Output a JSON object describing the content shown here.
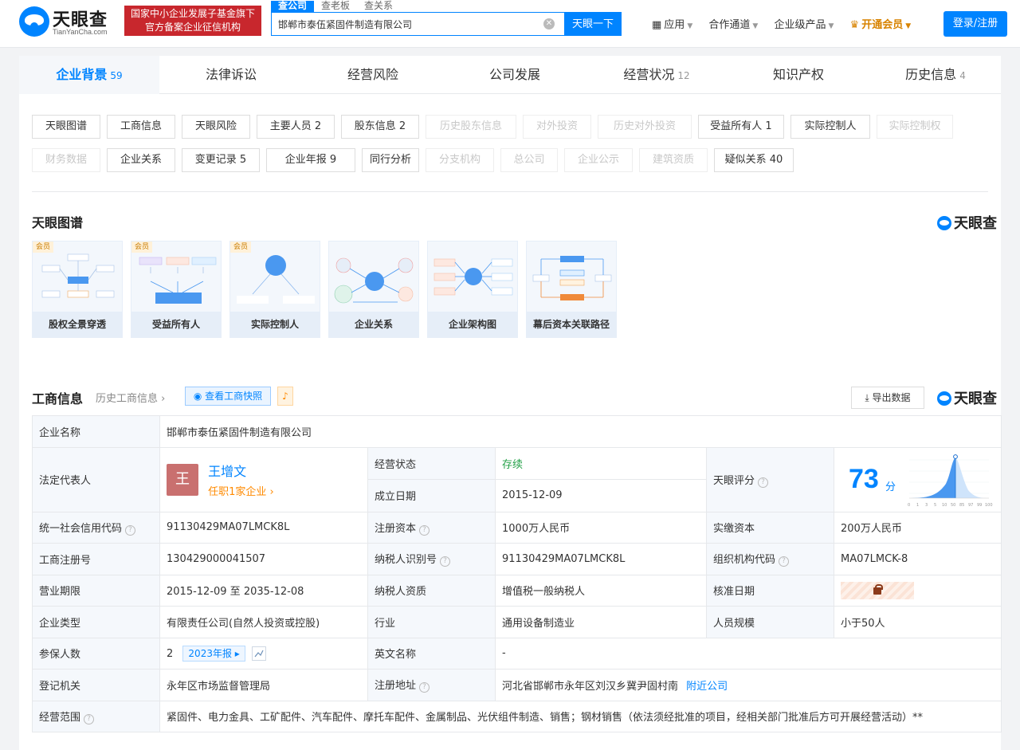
{
  "header": {
    "logo_text": "天眼查",
    "logo_sub": "TianYanCha.com",
    "badge_line1": "国家中小企业发展子基金旗下",
    "badge_line2": "官方备案企业征信机构",
    "search_tabs": [
      "查公司",
      "查老板",
      "查关系"
    ],
    "search_value": "邯郸市泰伍紧固件制造有限公司",
    "search_button": "天眼一下",
    "nav": [
      "应用",
      "合作通道",
      "企业级产品",
      "开通会员"
    ],
    "login": "登录/注册"
  },
  "tabs": [
    {
      "label": "企业背景",
      "count": "59"
    },
    {
      "label": "法律诉讼",
      "count": ""
    },
    {
      "label": "经营风险",
      "count": ""
    },
    {
      "label": "公司发展",
      "count": ""
    },
    {
      "label": "经营状况",
      "count": "12"
    },
    {
      "label": "知识产权",
      "count": ""
    },
    {
      "label": "历史信息",
      "count": "4"
    }
  ],
  "chips_row1": [
    {
      "label": "天眼图谱",
      "disabled": false
    },
    {
      "label": "工商信息",
      "disabled": false
    },
    {
      "label": "天眼风险",
      "disabled": false
    },
    {
      "label": "主要人员 2",
      "disabled": false
    },
    {
      "label": "股东信息 2",
      "disabled": false
    },
    {
      "label": "历史股东信息",
      "disabled": true
    },
    {
      "label": "对外投资",
      "disabled": true
    },
    {
      "label": "历史对外投资",
      "disabled": true
    },
    {
      "label": "受益所有人 1",
      "disabled": false
    },
    {
      "label": "实际控制人",
      "disabled": false
    },
    {
      "label": "实际控制权",
      "disabled": true
    }
  ],
  "chips_row2": [
    {
      "label": "财务数据",
      "disabled": true
    },
    {
      "label": "企业关系",
      "disabled": false
    },
    {
      "label": "变更记录 5",
      "disabled": false
    },
    {
      "label": "企业年报 9",
      "disabled": false
    },
    {
      "label": "同行分析",
      "disabled": false
    },
    {
      "label": "分支机构",
      "disabled": true
    },
    {
      "label": "总公司",
      "disabled": true
    },
    {
      "label": "企业公示",
      "disabled": true
    },
    {
      "label": "建筑资质",
      "disabled": true
    },
    {
      "label": "疑似关系 40",
      "disabled": false
    }
  ],
  "graph": {
    "title": "天眼图谱",
    "brand": "天眼查",
    "vip_label": "会员",
    "cards": [
      "股权全景穿透",
      "受益所有人",
      "实际控制人",
      "企业关系",
      "企业架构图",
      "幕后资本关联路径"
    ]
  },
  "biz": {
    "title": "工商信息",
    "history_link": "历史工商信息",
    "snapshot": "查看工商快照",
    "export": "导出数据",
    "brand": "天眼查",
    "labels": {
      "name": "企业名称",
      "legal_rep": "法定代表人",
      "status": "经营状态",
      "founded": "成立日期",
      "score": "天眼评分",
      "credit_code": "统一社会信用代码",
      "reg_capital": "注册资本",
      "paid_capital": "实缴资本",
      "reg_no": "工商注册号",
      "taxpayer_id": "纳税人识别号",
      "org_code": "组织机构代码",
      "term": "营业期限",
      "taxpayer_type": "纳税人资质",
      "approve_date": "核准日期",
      "company_type": "企业类型",
      "industry": "行业",
      "staff": "人员规模",
      "insured": "参保人数",
      "en_name": "英文名称",
      "authority": "登记机关",
      "address": "注册地址",
      "scope": "经营范围"
    },
    "values": {
      "name": "邯郸市泰伍紧固件制造有限公司",
      "avatar_char": "王",
      "legal_rep": "王增文",
      "legal_rep_sub": "任职1家企业",
      "status": "存续",
      "founded": "2015-12-09",
      "score": "73",
      "score_unit": "分",
      "credit_code": "91130429MA07LMCK8L",
      "reg_capital": "1000万人民币",
      "paid_capital": "200万人民币",
      "reg_no": "130429000041507",
      "taxpayer_id": "91130429MA07LMCK8L",
      "org_code": "MA07LMCK-8",
      "term": "2015-12-09 至 2035-12-08",
      "taxpayer_type": "增值税一般纳税人",
      "company_type": "有限责任公司(自然人投资或控股)",
      "industry": "通用设备制造业",
      "staff": "小于50人",
      "insured": "2",
      "insured_year": "2023年报",
      "en_name": "-",
      "authority": "永年区市场监督管理局",
      "address": "河北省邯郸市永年区刘汉乡冀尹固村南",
      "nearby": "附近公司",
      "scope": "紧固件、电力金具、工矿配件、汽车配件、摩托车配件、金属制品、光伏组件制造、销售；钢材销售（依法须经批准的项目，经相关部门批准后方可开展经营活动）**"
    },
    "score_axis": [
      "0",
      "1",
      "3",
      "5",
      "10",
      "50",
      "85",
      "97",
      "99",
      "100"
    ]
  },
  "colors": {
    "brand": "#0084ff",
    "badge": "#c8272d",
    "vip": "#d88300"
  }
}
